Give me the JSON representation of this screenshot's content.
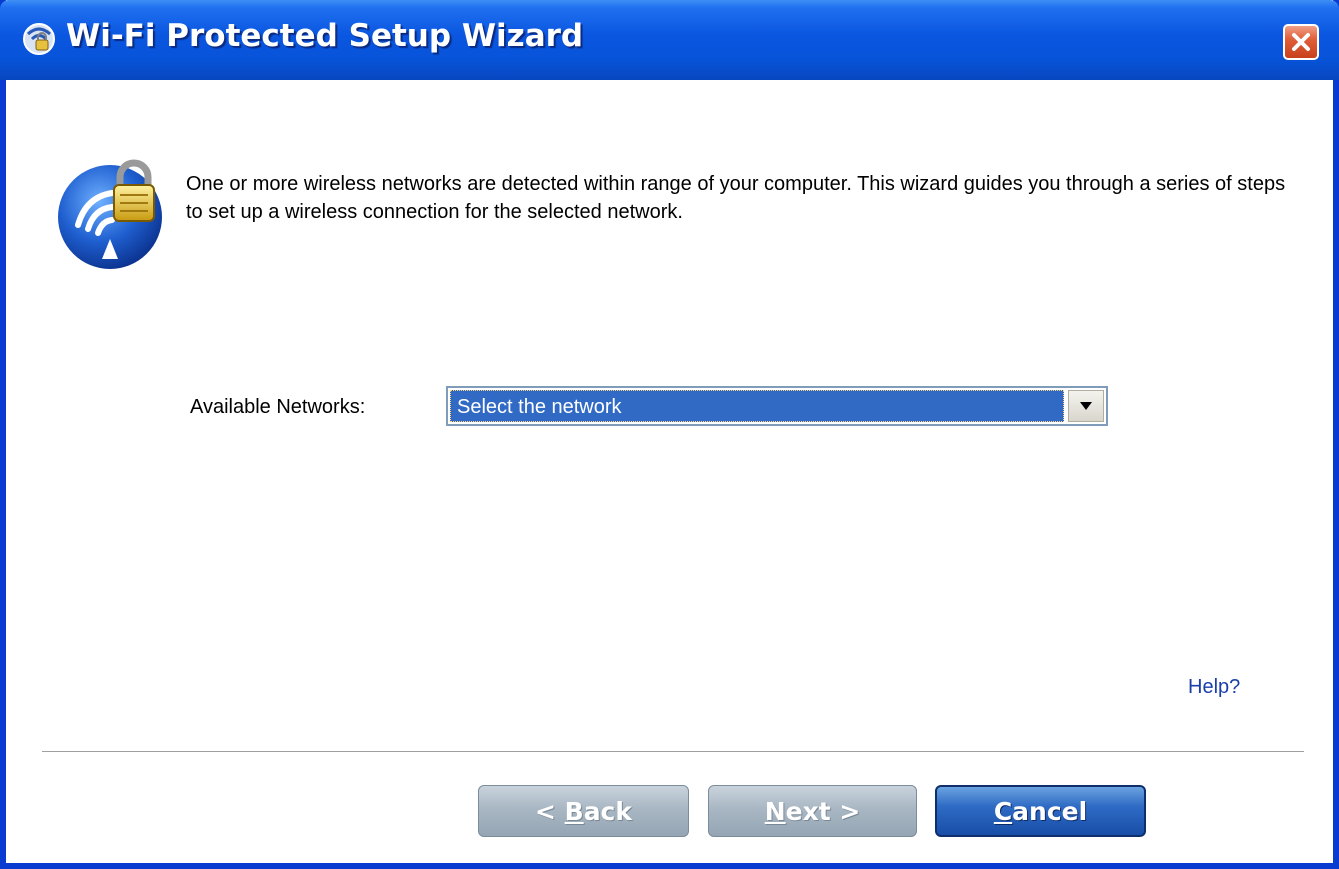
{
  "window": {
    "title": "Wi-Fi Protected Setup Wizard"
  },
  "intro": {
    "text": "One or more wireless networks are detected within range of your computer. This wizard guides you through a series of steps to set up a wireless connection for the selected network."
  },
  "networks": {
    "label": "Available Networks:",
    "selected": "Select the network"
  },
  "help": {
    "label": "Help?"
  },
  "buttons": {
    "back_prefix": "< ",
    "back_mnemonic": "B",
    "back_rest": "ack",
    "next_mnemonic": "N",
    "next_rest": "ext >",
    "cancel_mnemonic": "C",
    "cancel_rest": "ancel"
  },
  "colors": {
    "titlebar": "#0a56e0",
    "selection": "#316ac5",
    "link": "#1a3faa"
  },
  "icons": {
    "title": "wps-wizard-icon",
    "close": "close-icon",
    "wizard": "wireless-lock-icon",
    "dropdown": "chevron-down-icon"
  }
}
